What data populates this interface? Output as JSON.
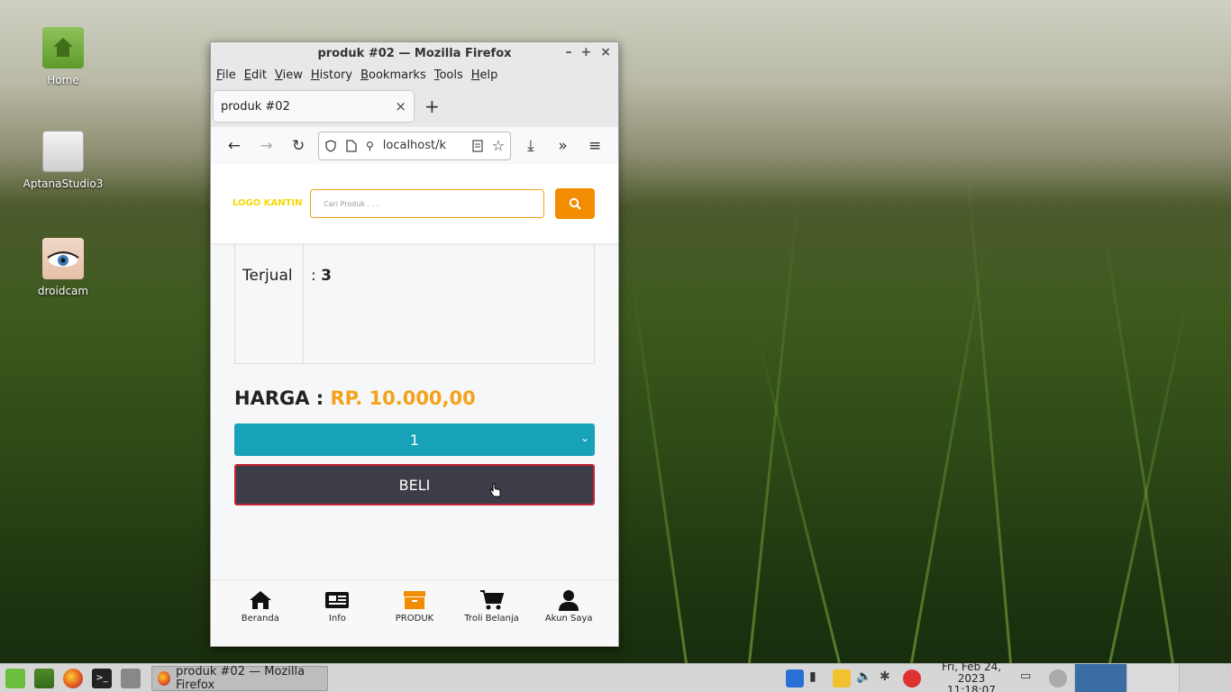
{
  "desktop": {
    "icons": [
      {
        "label": "Home"
      },
      {
        "label": "AptanaStudio3"
      },
      {
        "label": "droidcam"
      }
    ]
  },
  "window": {
    "title": "produk #02 — Mozilla Firefox",
    "menu": [
      "File",
      "Edit",
      "View",
      "History",
      "Bookmarks",
      "Tools",
      "Help"
    ],
    "tab_title": "produk #02",
    "url": "localhost/k"
  },
  "page": {
    "logo": "LOGO KANTIN",
    "search_placeholder": "Cari Produk . . .",
    "sold_label": "Terjual",
    "sold_value_prefix": ": ",
    "sold_value": "3",
    "price_label": "HARGA : ",
    "price_value": "RP. 10.000,00",
    "quantity": "1",
    "buy_label": "BELI",
    "bottom_nav": [
      {
        "label": "Beranda",
        "icon": "home-icon"
      },
      {
        "label": "Info",
        "icon": "newspaper-icon"
      },
      {
        "label": "PRODUK",
        "icon": "box-icon"
      },
      {
        "label": "Troli Belanja",
        "icon": "cart-icon"
      },
      {
        "label": "Akun Saya",
        "icon": "user-icon"
      }
    ],
    "accent_color": "#f28c00",
    "quantity_color": "#17a2b8",
    "buy_color": "#3d3d48"
  },
  "taskbar": {
    "task_label": "produk #02 — Mozilla Firefox",
    "date": "Fri, Feb 24, 2023",
    "time": "11:18:07"
  }
}
